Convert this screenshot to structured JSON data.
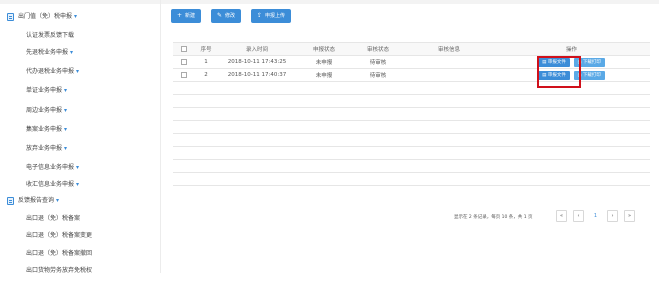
{
  "sidebar": {
    "items": [
      {
        "label": "出门值（免）税申报",
        "caret": true,
        "icon": "document-icon",
        "level": 0
      },
      {
        "label": "认证发票反馈下载",
        "caret": false,
        "level": 1
      },
      {
        "label": "先退税业务申报",
        "caret": true,
        "level": 1
      },
      {
        "label": "代办退税业务申报",
        "caret": true,
        "level": 1
      },
      {
        "label": "单证业务申报",
        "caret": true,
        "level": 1
      },
      {
        "label": "周边业务申报",
        "caret": true,
        "level": 1
      },
      {
        "label": "集案业务申报",
        "caret": true,
        "level": 1
      },
      {
        "label": "放弃业务申报",
        "caret": true,
        "level": 1
      },
      {
        "label": "电子信息业务申报",
        "caret": true,
        "level": 1
      },
      {
        "label": "收汇信息业务申报",
        "caret": true,
        "level": 1
      },
      {
        "label": "反馈报告查询",
        "caret": true,
        "icon": "document-icon",
        "level": 0
      },
      {
        "label": "出口退（免）税备案",
        "caret": false,
        "level": 1
      },
      {
        "label": "出口退（免）税备案变更",
        "caret": false,
        "level": 1
      },
      {
        "label": "出口退（免）税备案撤回",
        "caret": false,
        "level": 1
      },
      {
        "label": "出口货物劳务放弃免税权",
        "caret": false,
        "level": 1
      }
    ]
  },
  "toolbar": {
    "add": {
      "icon": "plus-icon",
      "label": "新建"
    },
    "edit": {
      "icon": "edit-icon",
      "label": "修改"
    },
    "upload": {
      "icon": "upload-icon",
      "label": "申报上传"
    }
  },
  "table": {
    "headers": [
      "",
      "序号",
      "录入时间",
      "申报状态",
      "审核状态",
      "审核信息",
      "操作"
    ],
    "rows": [
      {
        "no": "1",
        "time": "2018-10-11 17:43:25",
        "declare": "未申报",
        "audit": "待审核",
        "info": "",
        "op1": "审报文件",
        "op2": "下载打印"
      },
      {
        "no": "2",
        "time": "2018-10-11 17:40:37",
        "declare": "未申报",
        "audit": "待审核",
        "info": "",
        "op1": "审报文件",
        "op2": "下载打印"
      }
    ],
    "op_icons": {
      "op1": "file-icon",
      "op2": "print-icon"
    }
  },
  "pager": {
    "info": "显示在 2 条记录，每页 10 条，共 1 页",
    "first": "«",
    "prev": "‹",
    "current": "1",
    "next": "›",
    "last": "»"
  },
  "colors": {
    "accent": "#3c8dd8",
    "highlight": "#d0101b"
  }
}
